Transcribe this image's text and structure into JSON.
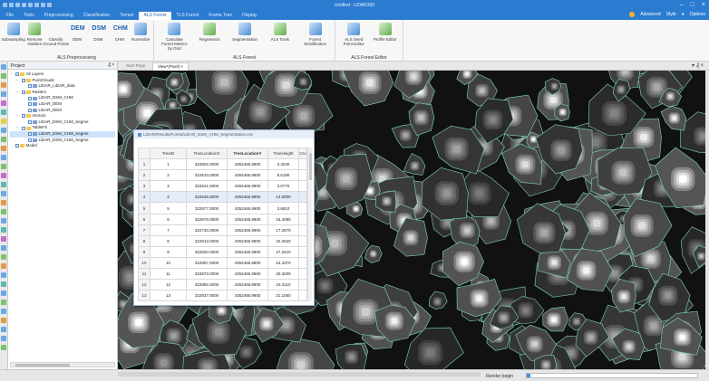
{
  "titlebar": {
    "title": "Untitled - LiDAR360"
  },
  "menu": {
    "tabs": [
      "File",
      "Tools",
      "Preprocessing",
      "Classification",
      "Terrain",
      "ALS Forest",
      "TLS Forest",
      "Frame Tree",
      "Display"
    ],
    "active_tab": "ALS Forest",
    "right": {
      "mode": "Advanced",
      "style": "Style",
      "options": "Options"
    }
  },
  "ribbon": {
    "groups": [
      {
        "label": "ALS Preprocessing",
        "buttons": [
          "Subsampling",
          "Remove Outliers",
          "Classify Ground Points",
          "DEM",
          "DSM",
          "CHM",
          "Normalize"
        ]
      },
      {
        "label": "ALS Forest",
        "buttons": [
          "Calculate Forest Metrics by Grid",
          "Regression",
          "Segmentation",
          "ALS Tools",
          "Forest Stratification"
        ]
      },
      {
        "label": "ALS Forest Editor",
        "buttons": [
          "ALS Seed Point Editor",
          "Profile Editor"
        ]
      }
    ]
  },
  "doctabs": [
    "Start Page",
    "View*(Pixel)"
  ],
  "doctabs_active": 1,
  "project": {
    "title": "Project",
    "tree": [
      {
        "depth": 0,
        "label": "All Layers",
        "exp": "−",
        "icon": "folder"
      },
      {
        "depth": 1,
        "label": "PointClouds",
        "exp": "−",
        "icon": "folder"
      },
      {
        "depth": 2,
        "label": "LIDAR_LiDAR_data",
        "exp": "",
        "icon": "layer"
      },
      {
        "depth": 1,
        "label": "Rasters",
        "exp": "−",
        "icon": "folder"
      },
      {
        "depth": 2,
        "label": "LiDAR_DSM_CHM",
        "exp": "",
        "icon": "layer"
      },
      {
        "depth": 2,
        "label": "LiDAR_DEM",
        "exp": "",
        "icon": "layer"
      },
      {
        "depth": 2,
        "label": "LiDAR_DEM",
        "exp": "",
        "icon": "layer"
      },
      {
        "depth": 1,
        "label": "Vectors",
        "exp": "−",
        "icon": "folder"
      },
      {
        "depth": 2,
        "label": "LiDAR_DSM_CHM_Segme",
        "exp": "",
        "icon": "layer"
      },
      {
        "depth": 1,
        "label": "TableFS",
        "exp": "−",
        "icon": "folder"
      },
      {
        "depth": 2,
        "label": "LiDAR_DSM_CHM_Segme",
        "exp": "",
        "icon": "layer",
        "selected": true
      },
      {
        "depth": 2,
        "label": "LiDAR_DSM_CHM_Segme",
        "exp": "",
        "icon": "layer"
      },
      {
        "depth": 0,
        "label": "Model",
        "exp": "",
        "icon": "folder"
      }
    ]
  },
  "attr_table": {
    "title": "LiDAR/Results/Forest/LiDAR_DSM_CHM_Segmentation.csv",
    "columns": [
      "",
      "TreeID",
      "TreeLocationX",
      "TreeLocationY",
      "TreeHeight",
      "Cro"
    ],
    "selected_column": 3,
    "rows": [
      [
        "1",
        "1",
        "322502.0000",
        "4352465.9900",
        "2.4040",
        ""
      ],
      [
        "2",
        "2",
        "322510.0000",
        "4352465.9900",
        "5.6190",
        ""
      ],
      [
        "3",
        "3",
        "322521.0000",
        "4352465.9900",
        "3.6770",
        ""
      ],
      [
        "4",
        "4",
        "322546.0000",
        "4352465.9900",
        "14.0000",
        ""
      ],
      [
        "5",
        "5",
        "322577.0000",
        "4352465.9900",
        "3.6810",
        ""
      ],
      [
        "6",
        "6",
        "322678.0000",
        "4352465.9900",
        "16.4080",
        ""
      ],
      [
        "7",
        "7",
        "322733.0000",
        "4352465.9900",
        "17.2870",
        ""
      ],
      [
        "8",
        "8",
        "322813.0000",
        "4352465.9900",
        "22.2620",
        ""
      ],
      [
        "9",
        "9",
        "322820.0000",
        "4352465.9900",
        "27.3410",
        ""
      ],
      [
        "10",
        "10",
        "322867.0000",
        "4352465.9900",
        "24.3370",
        ""
      ],
      [
        "11",
        "11",
        "322873.0000",
        "4352465.9900",
        "20.3200",
        ""
      ],
      [
        "12",
        "12",
        "322892.0000",
        "4352465.9900",
        "16.3110",
        ""
      ],
      [
        "13",
        "13",
        "322937.0000",
        "4352466.9900",
        "21.1060",
        ""
      ]
    ],
    "highlighted_row": 3
  },
  "status": {
    "label": "Render begin",
    "progress": 0.02
  },
  "colors": {
    "accent": "#2b7bd1",
    "segment_edge": "#7fd6c4"
  }
}
